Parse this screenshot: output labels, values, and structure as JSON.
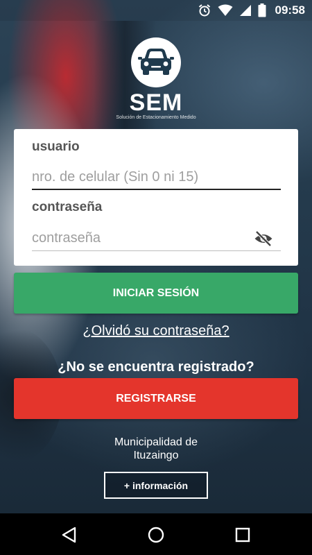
{
  "status_bar": {
    "time": "09:58",
    "icons": [
      "alarm-icon",
      "wifi-icon",
      "signal-icon",
      "battery-icon"
    ]
  },
  "logo": {
    "icon": "car-icon",
    "title": "SEM",
    "subtitle": "Solución de Estacionamiento Medido"
  },
  "login_form": {
    "user_label": "usuario",
    "user_placeholder": "nro. de celular (Sin 0 ni 15)",
    "user_value": "",
    "password_label": "contraseña",
    "password_placeholder": "contraseña",
    "password_value": "",
    "password_toggle_icon": "eye-off-icon"
  },
  "buttons": {
    "login": "INICIAR SESIÓN",
    "forgot_password": "¿Olvidó su contraseña?",
    "not_registered": "¿No se encuentra registrado?",
    "register": "REGISTRARSE",
    "more_info": "+ información"
  },
  "footer": {
    "municipality_line1": "Municipalidad de",
    "municipality_line2": "Ituzaingo"
  },
  "colors": {
    "login_button": "#38a868",
    "register_button": "#e4352c",
    "logo_icon": "#1f3a4d"
  },
  "nav_bar": {
    "buttons": [
      "back-icon",
      "home-icon",
      "recents-icon"
    ]
  }
}
